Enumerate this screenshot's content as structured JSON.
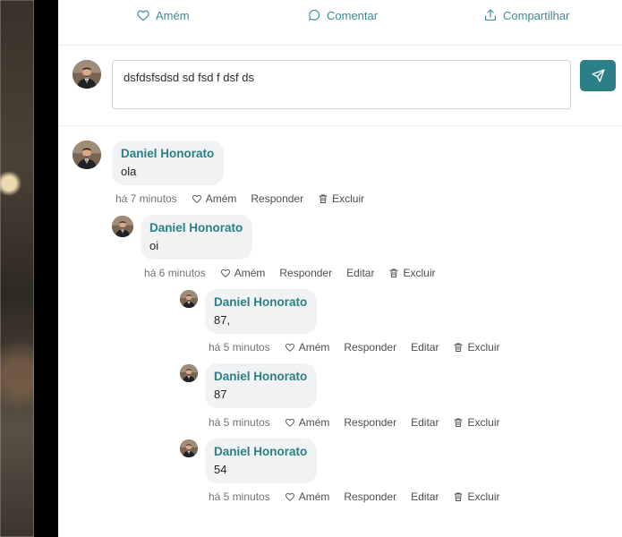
{
  "post_actions": {
    "amen": "Amém",
    "comment": "Comentar",
    "share": "Compartilhar"
  },
  "composer": {
    "value": "dsfdsfsdsd sd fsd f dsf ds",
    "send_icon": "send-icon"
  },
  "comments": [
    {
      "author": "Daniel Honorato",
      "text": "ola",
      "time": "há 7 minutos",
      "amen": "Amém",
      "reply": "Responder",
      "delete": "Excluir"
    },
    {
      "author": "Daniel Honorato",
      "text": "oi",
      "time": "há 6 minutos",
      "amen": "Amém",
      "reply": "Responder",
      "edit": "Editar",
      "delete": "Excluir"
    },
    {
      "author": "Daniel Honorato",
      "text": "87,",
      "time": "há 5 minutos",
      "amen": "Amém",
      "reply": "Responder",
      "edit": "Editar",
      "delete": "Excluir"
    },
    {
      "author": "Daniel Honorato",
      "text": "87",
      "time": "há 5 minutos",
      "amen": "Amém",
      "reply": "Responder",
      "edit": "Editar",
      "delete": "Excluir"
    },
    {
      "author": "Daniel Honorato",
      "text": "54",
      "time": "há 5 minutos",
      "amen": "Amém",
      "reply": "Responder",
      "edit": "Editar",
      "delete": "Excluir"
    }
  ],
  "colors": {
    "accent": "#2b7f86",
    "link": "#3c8a92",
    "bubble": "#f1f2f3"
  }
}
